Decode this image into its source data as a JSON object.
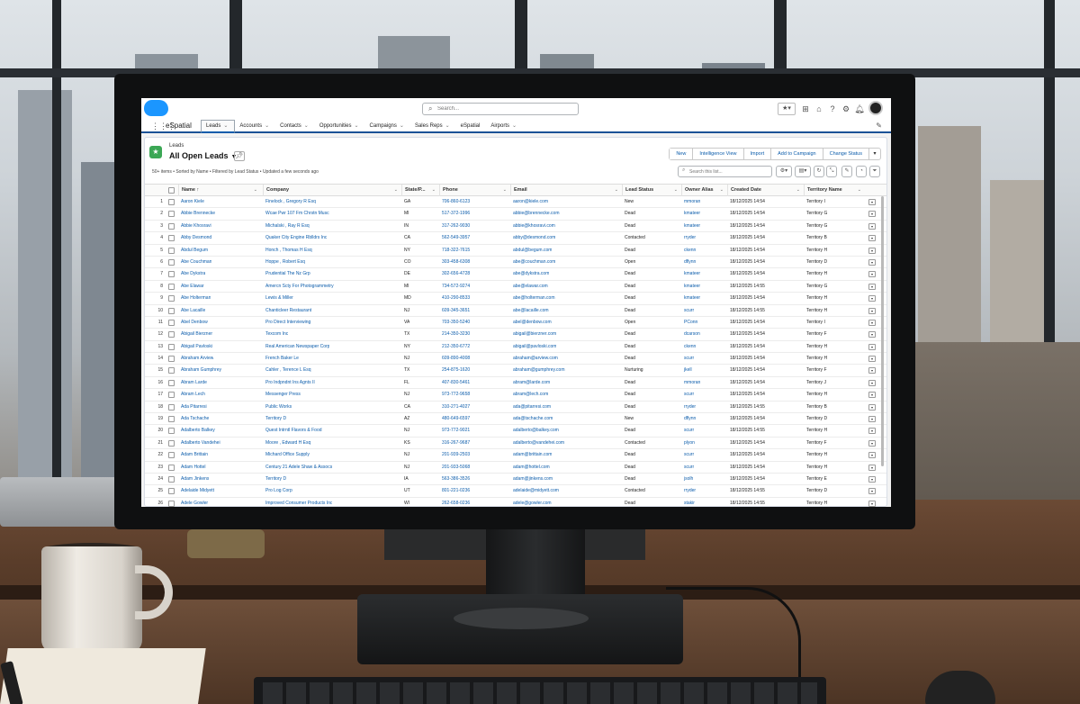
{
  "app": {
    "name": "eSpatial",
    "search_placeholder": "Search...",
    "nav": [
      {
        "label": "Leads",
        "active": true
      },
      {
        "label": "Accounts",
        "active": false
      },
      {
        "label": "Contacts",
        "active": false
      },
      {
        "label": "Opportunities",
        "active": false
      },
      {
        "label": "Campaigns",
        "active": false
      },
      {
        "label": "Sales Reps",
        "active": false
      },
      {
        "label": "eSpatial",
        "active": false
      },
      {
        "label": "Airports",
        "active": false
      }
    ]
  },
  "list_view": {
    "object_label": "Leads",
    "title": "All Open Leads",
    "meta": "50+ items • Sorted by Name • Filtered by Lead Status • Updated a few seconds ago",
    "actions": [
      "New",
      "Intelligence View",
      "Import",
      "Add to Campaign",
      "Change Status"
    ],
    "search_placeholder": "Search this list...",
    "columns": [
      "Name ↑",
      "Company",
      "State/P...",
      "Phone",
      "Email",
      "Lead Status",
      "Owner Alias",
      "Created Date",
      "Territory Name"
    ],
    "rows": [
      [
        "1",
        "Aaron Kiele",
        "Finelock , Gregory R Esq",
        "GA",
        "706-860-6123",
        "aaron@kiele.com",
        "New",
        "mmoran",
        "18/12/2025 14:54",
        "Territory I"
      ],
      [
        "2",
        "Abbie Brennecke",
        "Wcae Pwr 107 Fm Chrstn Musc",
        "MI",
        "517-372-1996",
        "abbie@brennecke.com",
        "Dead",
        "kmateer",
        "18/12/2025 14:54",
        "Territory G"
      ],
      [
        "3",
        "Abbie Khosravi",
        "Michalski , Ray R Esq",
        "IN",
        "317-262-9030",
        "abbie@khosravi.com",
        "Dead",
        "kmateer",
        "18/12/2025 14:54",
        "Territory G"
      ],
      [
        "4",
        "Abby Desmond",
        "Quaker City Engine Rblldrs Inc",
        "CA",
        "562-549-3957",
        "abby@desmond.com",
        "Contacted",
        "rryder",
        "18/12/2025 14:54",
        "Territory B"
      ],
      [
        "5",
        "Abdul Begum",
        "Honch , Thomas H Esq",
        "NY",
        "718-322-7615",
        "abdul@begum.com",
        "Dead",
        "ckenn",
        "18/12/2025 14:54",
        "Territory H"
      ],
      [
        "6",
        "Abe Couchman",
        "Hoppe , Robert Esq",
        "CO",
        "303-458-6308",
        "abe@couchman.com",
        "Open",
        "dflynn",
        "18/12/2025 14:54",
        "Territory D"
      ],
      [
        "7",
        "Abe Dykstra",
        "Prudential The Nz Grp",
        "DE",
        "302-656-4728",
        "abe@dykstra.com",
        "Dead",
        "kmateer",
        "18/12/2025 14:54",
        "Territory H"
      ],
      [
        "8",
        "Abe Elawar",
        "Amercn Scty For Photogrammetry",
        "MI",
        "734-572-9274",
        "abe@elawar.com",
        "Dead",
        "kmateer",
        "18/12/2025 14:55",
        "Territory G"
      ],
      [
        "9",
        "Abe Holterman",
        "Lewis & Miller",
        "MD",
        "410-290-8533",
        "abe@holterman.com",
        "Dead",
        "kmateer",
        "18/12/2025 14:54",
        "Territory H"
      ],
      [
        "10",
        "Abe Lacaille",
        "Chanticleer Restaurant",
        "NJ",
        "609-345-3651",
        "abe@lacaille.com",
        "Dead",
        "scurr",
        "18/12/2025 14:55",
        "Territory H"
      ],
      [
        "11",
        "Abel Denbow",
        "Pro Direct Interviewing",
        "VA",
        "703-350-5240",
        "abel@denbow.com",
        "Open",
        "PConn",
        "18/12/2025 14:54",
        "Territory I"
      ],
      [
        "12",
        "Abigail Bierzner",
        "Texcom Inc",
        "TX",
        "214-350-3230",
        "abigail@bierzner.com",
        "Dead",
        "dcarson",
        "18/12/2025 14:54",
        "Territory F"
      ],
      [
        "13",
        "Abigail Pavloski",
        "Real American Newspaper Corp",
        "NY",
        "212-350-6772",
        "abigail@pavloski.com",
        "Dead",
        "ckenn",
        "18/12/2025 14:54",
        "Territory H"
      ],
      [
        "14",
        "Abraham Arview",
        "French Baker Le",
        "NJ",
        "609-890-4008",
        "abraham@arview.com",
        "Dead",
        "scurr",
        "18/12/2025 14:54",
        "Territory H"
      ],
      [
        "15",
        "Abraham Gumphrey",
        "Cahler , Terence L Esq",
        "TX",
        "254-875-1620",
        "abraham@gumphrey.com",
        "Nurturing",
        "jkell",
        "18/12/2025 14:54",
        "Territory F"
      ],
      [
        "16",
        "Abram Larde",
        "Pro Indpndnt Ins Agnts II",
        "FL",
        "407-830-5461",
        "abram@larde.com",
        "Dead",
        "mmoran",
        "18/12/2025 14:54",
        "Territory J"
      ],
      [
        "17",
        "Abram Lech",
        "Messenger Press",
        "NJ",
        "973-772-9658",
        "abram@lech.com",
        "Dead",
        "scurr",
        "18/12/2025 14:54",
        "Territory H"
      ],
      [
        "18",
        "Ada Pitarresi",
        "Public Works",
        "CA",
        "310-271-4027",
        "ada@pitarresi.com",
        "Dead",
        "rryder",
        "18/12/2025 14:55",
        "Territory B"
      ],
      [
        "19",
        "Ada Tschache",
        "Territory D",
        "AZ",
        "480-649-6597",
        "ada@tschache.com",
        "New",
        "dflynn",
        "18/12/2025 14:54",
        "Territory D"
      ],
      [
        "20",
        "Adalberto Balkey",
        "Quest Intrntl Flavors & Food",
        "NJ",
        "973-772-9021",
        "adalberto@balkey.com",
        "Dead",
        "scurr",
        "18/12/2025 14:55",
        "Territory H"
      ],
      [
        "21",
        "Adalberto Vandehei",
        "Moore , Edward H Esq",
        "KS",
        "316-267-9687",
        "adalberto@vandehei.com",
        "Contacted",
        "plyon",
        "18/12/2025 14:54",
        "Territory F"
      ],
      [
        "22",
        "Adam Brittain",
        "Michard Office Supply",
        "NJ",
        "201-939-2503",
        "adam@brittain.com",
        "Dead",
        "scurr",
        "18/12/2025 14:54",
        "Territory H"
      ],
      [
        "23",
        "Adam Hottel",
        "Century 21 Adele Shaw & Assocs",
        "NJ",
        "201-933-5068",
        "adam@hottel.com",
        "Dead",
        "scurr",
        "18/12/2025 14:54",
        "Territory H"
      ],
      [
        "24",
        "Adam Jinkens",
        "Territory D",
        "IA",
        "563-386-3526",
        "adam@jinkens.com",
        "Dead",
        "jsolh",
        "18/12/2025 14:54",
        "Territory E"
      ],
      [
        "25",
        "Adelaide Midyett",
        "Pro Log Corp",
        "UT",
        "801-221-0236",
        "adelaide@midyett.com",
        "Contacted",
        "rryder",
        "18/12/2025 14:55",
        "Territory D"
      ],
      [
        "26",
        "Adele Gowler",
        "Improved Consumer Products Inc",
        "WI",
        "262-658-0236",
        "adele@gowler.com",
        "Dead",
        "stakir",
        "18/12/2025 14:55",
        "Territory H"
      ]
    ]
  },
  "colors": {
    "brand": "#1b96ff",
    "link": "#0b5cab",
    "leads_icon": "#3ba755"
  }
}
